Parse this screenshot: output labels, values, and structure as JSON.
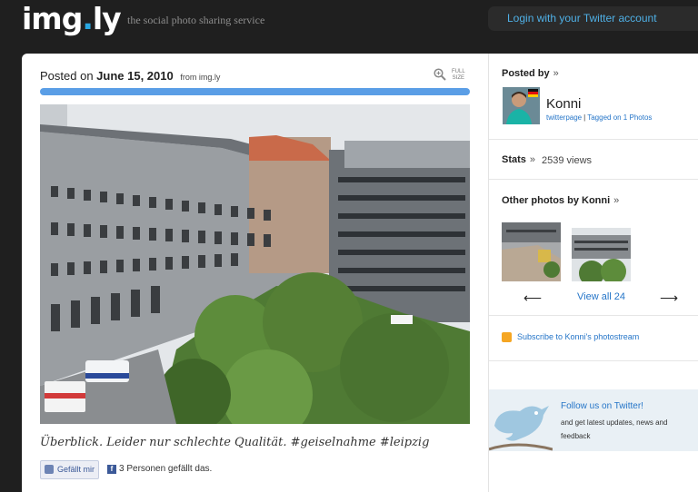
{
  "header": {
    "logo_main": "img",
    "logo_dot": ".",
    "logo_suffix": "ly",
    "tagline": "the social photo sharing service",
    "login_label": "Login with your Twitter account"
  },
  "post": {
    "posted_prefix": "Posted on",
    "date": "June 15, 2010",
    "from": "from img.ly",
    "full_size_line1": "FULL",
    "full_size_line2": "SIZE",
    "caption": "Überblick. Leider nur schlechte Qualität. #geiselnahme #leipzig",
    "like_label": "Gefällt mir",
    "like_count_text": "3 Personen gefällt das."
  },
  "sidebar": {
    "posted_by_title": "Posted by",
    "chevron": "»",
    "user_name": "Konni",
    "twitterpage_label": "twitterpage",
    "link_separator": "|",
    "tagged_label": "Tagged on 1 Photos",
    "stats_title": "Stats",
    "views": "2539 views",
    "other_photos_title": "Other photos by Konni",
    "prev_arrow": "⟵",
    "next_arrow": "⟶",
    "view_all_label": "View all 24",
    "subscribe_label": "Subscribe to Konni's photostream",
    "twitter_follow": "Follow us on Twitter!",
    "twitter_updates": "and get latest updates, news and feedback"
  },
  "colors": {
    "accent_blue": "#2575c8",
    "progress_bar": "#5a9ee6",
    "header_bg": "#1f1f1f"
  }
}
